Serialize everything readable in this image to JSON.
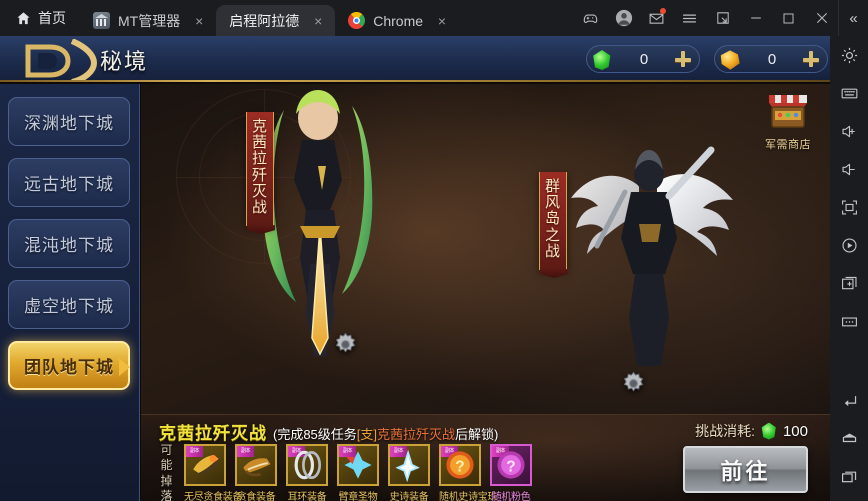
{
  "emulator": {
    "home_label": "首页",
    "home_icon": "home-icon",
    "tabs": [
      {
        "label": "MT管理器",
        "icon": "mt-manager-icon",
        "close": "×",
        "active": false
      },
      {
        "label": "启程阿拉德",
        "icon": "game-icon",
        "close": "×",
        "active": true
      },
      {
        "label": "Chrome",
        "icon": "chrome-icon",
        "close": "×",
        "active": false
      }
    ],
    "sysbuttons": [
      {
        "name": "gamepad-icon"
      },
      {
        "name": "account-avatar-icon"
      },
      {
        "name": "mail-icon",
        "badge": true
      },
      {
        "name": "menu-hamburger-icon"
      },
      {
        "name": "resize-window-icon"
      },
      {
        "name": "minimize-icon"
      },
      {
        "name": "maximize-icon"
      },
      {
        "name": "close-icon"
      }
    ],
    "collapse_label": "«",
    "toolbar": [
      {
        "name": "settings-gear-icon"
      },
      {
        "name": "keyboard-icon"
      },
      {
        "name": "volume-up-icon"
      },
      {
        "name": "volume-down-icon"
      },
      {
        "name": "fullscreen-icon"
      },
      {
        "name": "screen-record-icon"
      },
      {
        "name": "add-instance-icon"
      },
      {
        "name": "more-options-icon"
      }
    ],
    "navbar": [
      {
        "name": "android-back-icon"
      },
      {
        "name": "android-home-icon"
      },
      {
        "name": "android-recents-icon"
      }
    ]
  },
  "game": {
    "header": {
      "title": "秘境",
      "logo_icon": "game-logo-icon",
      "currencies": [
        {
          "name": "gem-currency",
          "icon": "gem-icon",
          "value": "0",
          "plus": "+"
        },
        {
          "name": "gold-currency",
          "icon": "coin-icon",
          "value": "0",
          "plus": "+"
        }
      ]
    },
    "sidebar": {
      "items": [
        {
          "label": "深渊地下城",
          "selected": false
        },
        {
          "label": "远古地下城",
          "selected": false
        },
        {
          "label": "混沌地下城",
          "selected": false
        },
        {
          "label": "虚空地下城",
          "selected": false
        },
        {
          "label": "团队地下城",
          "selected": true
        }
      ]
    },
    "map": {
      "banners": [
        {
          "name": "banner-kexila",
          "text": "克茜拉歼灭战"
        },
        {
          "name": "banner-qunfengdao",
          "text": "群风岛之战"
        }
      ],
      "shop": {
        "label": "军需商店",
        "icon": "shop-stall-icon"
      },
      "nodes": [
        {
          "name": "map-node-gear-left",
          "icon": "gear-icon"
        },
        {
          "name": "map-node-gear-right",
          "icon": "gear-icon"
        }
      ]
    },
    "bottom": {
      "quest_name": "克茜拉歼灭战",
      "condition_prefix": "(完成85级任务",
      "condition_tag": "[支]",
      "condition_quest": "克茜拉歼灭战",
      "condition_suffix": "后解锁)",
      "drop_label": "可能掉落",
      "drop_badge": "副本",
      "items": [
        {
          "name": "无尽贪食装备",
          "rarity": "epic"
        },
        {
          "name": "贪食装备",
          "rarity": "epic"
        },
        {
          "name": "耳环装备",
          "rarity": "epic"
        },
        {
          "name": "臂章圣物",
          "rarity": "epic"
        },
        {
          "name": "史诗装备",
          "rarity": "epic"
        },
        {
          "name": "随机史诗宝珠",
          "rarity": "epic"
        },
        {
          "name": "随机粉色",
          "rarity": "pink"
        }
      ],
      "cost_label": "挑战消耗:",
      "cost_icon": "gem-icon",
      "cost_value": "100",
      "go_button": "前往"
    }
  },
  "colors": {
    "accent_gold": "#e0a82c",
    "header_blue": "#1d2c4d",
    "quest_yellow": "#f2e23c",
    "banner_red": "#9c2c23",
    "pink_rarity": "#ef8ae6"
  }
}
